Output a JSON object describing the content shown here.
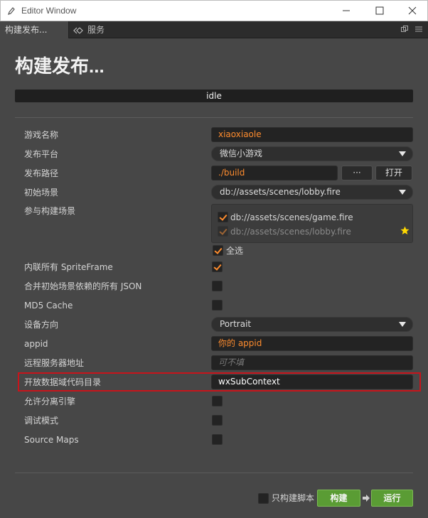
{
  "window": {
    "title": "Editor Window"
  },
  "tabs": [
    {
      "label": "构建发布..."
    },
    {
      "label": "服务"
    }
  ],
  "page": {
    "title": "构建发布...",
    "status": "idle"
  },
  "form": {
    "game_name": {
      "label": "游戏名称",
      "value": "xiaoxiaole"
    },
    "platform": {
      "label": "发布平台",
      "value": "微信小游戏"
    },
    "build_path": {
      "label": "发布路径",
      "value": "./build",
      "browse_label": "···",
      "open_label": "打开"
    },
    "start_scene": {
      "label": "初始场景",
      "value": "db://assets/scenes/lobby.fire"
    },
    "included_scenes": {
      "label": "参与构建场景",
      "items": [
        {
          "path": "db://assets/scenes/game.fire",
          "checked": true
        },
        {
          "path": "db://assets/scenes/lobby.fire",
          "checked": true,
          "disabled": true
        }
      ],
      "select_all_label": "全选"
    },
    "inline_spriteframe": {
      "label": "内联所有 SpriteFrame",
      "checked": true
    },
    "merge_json": {
      "label": "合并初始场景依赖的所有 JSON",
      "checked": false
    },
    "md5_cache": {
      "label": "MD5 Cache",
      "checked": false
    },
    "orientation": {
      "label": "设备方向",
      "value": "Portrait"
    },
    "appid": {
      "label": "appid",
      "value": "你的 appid"
    },
    "remote_server": {
      "label": "远程服务器地址",
      "placeholder": "可不填"
    },
    "subcontext": {
      "label": "开放数据域代码目录",
      "value": "wxSubContext"
    },
    "separate_engine": {
      "label": "允许分离引擎",
      "checked": false
    },
    "debug_mode": {
      "label": "调试模式",
      "checked": false
    },
    "source_maps": {
      "label": "Source Maps",
      "checked": false
    }
  },
  "footer": {
    "build_script_only_label": "只构建脚本",
    "build_script_only_checked": false,
    "build_label": "构建",
    "run_label": "运行"
  },
  "colors": {
    "accent": "#fe8c2e",
    "primary_button": "#5a9c34",
    "highlight_border": "#c8141b",
    "star": "#ffd800"
  }
}
